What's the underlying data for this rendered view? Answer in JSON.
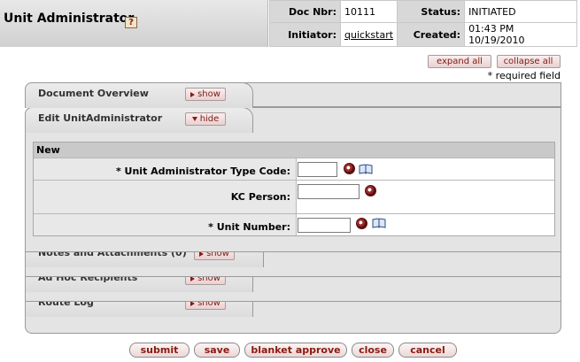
{
  "header": {
    "title": "Unit Administrator",
    "help_glyph": "?",
    "doc_nbr_label": "Doc Nbr:",
    "doc_nbr": "10111",
    "status_label": "Status:",
    "status": "INITIATED",
    "initiator_label": "Initiator:",
    "initiator": "quickstart",
    "created_label": "Created:",
    "created": "01:43 PM 10/19/2010"
  },
  "controls": {
    "expand_all": "expand all",
    "collapse_all": "collapse all",
    "required_note": "* required field"
  },
  "tabs": [
    {
      "label": "Document Overview",
      "button": "show"
    },
    {
      "label": "Edit UnitAdministrator",
      "button": "hide"
    },
    {
      "label": "Notes and Attachments (0)",
      "button": "show"
    },
    {
      "label": "Ad Hoc Recipients",
      "button": "show"
    },
    {
      "label": "Route Log",
      "button": "show"
    }
  ],
  "edit": {
    "section_header": "New",
    "fields": [
      {
        "label": "*  Unit Administrator Type Code:",
        "value": ""
      },
      {
        "label": "KC Person:",
        "value": ""
      },
      {
        "label": "*  Unit Number:",
        "value": ""
      }
    ]
  },
  "icons": {
    "search": "search-icon",
    "book": "book-icon",
    "help": "help-icon",
    "triangle": "triangle-icon"
  },
  "actions": {
    "submit": "submit",
    "save": "save",
    "blanket_approve": "blanket approve",
    "close": "close",
    "cancel": "cancel"
  },
  "colors": {
    "accent": "#8a1a10",
    "tab_bg": "#e4e4e4",
    "label_bg": "#d8d8d8"
  }
}
